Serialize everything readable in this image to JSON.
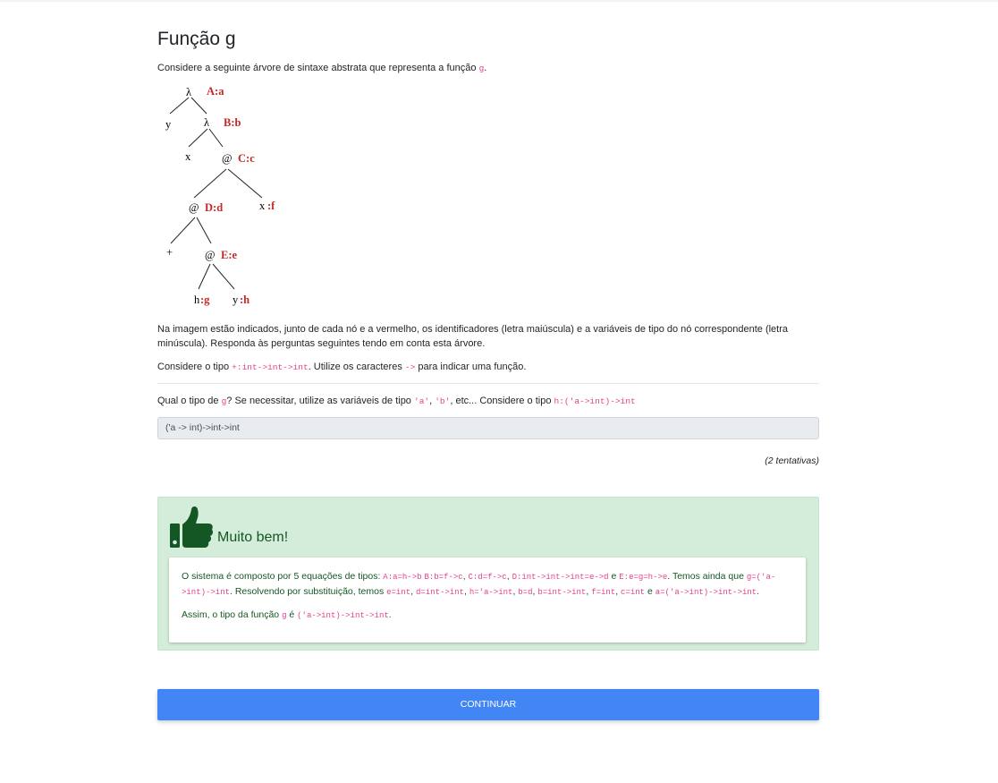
{
  "page": {
    "title": "Função g"
  },
  "intro": {
    "text": "Considere a seguinte árvore de sintaxe abstrata que representa a função ",
    "code": "g",
    "end": "."
  },
  "tree": {
    "nodes": {
      "lambda1": "λ",
      "lambda1_label": "A:a",
      "y1": "y",
      "lambda2": "λ",
      "lambda2_label": "B:b",
      "x1": "x",
      "at1": "@",
      "at1_label": "C:c",
      "at2": "@",
      "at2_label": "D:d",
      "x2": "x",
      "x2_label": ":f",
      "plus": "+",
      "at3": "@",
      "at3_label": "E:e",
      "h": "h",
      "h_label": ":g",
      "y2": "y",
      "y2_label": ":h"
    }
  },
  "description": "Na imagem estão indicados, junto de cada nó e a vermelho, os identificadores (letra maiúscula) e a variáveis de tipo do nó correspondente (letra minúscula). Responda às perguntas seguintes tendo em conta esta árvore.",
  "consider": {
    "a": "Considere o tipo ",
    "code1": "+:int->int->int",
    "b": ". Utilize os caracteres ",
    "code2": "->",
    "c": " para indicar uma função."
  },
  "question": {
    "a": "Qual o tipo de ",
    "code1": "g",
    "b": "? Se necessitar, utilize as variáveis de tipo ",
    "code2": "'a'",
    "c": ", ",
    "code3": "'b'",
    "d": ", etc... Considere o tipo ",
    "code4": "h:('a->int)->int"
  },
  "answer": {
    "value": "('a -> int)->int->int"
  },
  "attempts": "(2 tentativas)",
  "feedback": {
    "heading": "Muito bem!",
    "line1": {
      "t1": "O sistema é composto por 5 equações de tipos: ",
      "c1": "A:a=h->b",
      "t2": " ",
      "c2": "B:b=f->c",
      "t3": ", ",
      "c3": "C:d=f->c",
      "t4": ", ",
      "c4": "D:int->int->int=e->d",
      "t5": " e ",
      "c5": "E:e=g=h->e",
      "t6": ". Temos ainda que ",
      "c6a": "g=('a-",
      "c6b": ">int)->int",
      "t7": ". Resolvendo por substituição, temos ",
      "c7": "e=int",
      "t8": ", ",
      "c8": "d=int->int",
      "t9": ", ",
      "c9": "h='a->int",
      "t10": ", ",
      "c10": "b=d",
      "t11": ", ",
      "c11": "b=int->int",
      "t12": ", ",
      "c12": "f=int",
      "t13": ", ",
      "c13": "c=int",
      "t14": " e ",
      "c14": "a=('a->int)->int->int",
      "t15": "."
    },
    "line2": {
      "t1": "Assim, o tipo da função ",
      "c1": "g",
      "t2": " é ",
      "c2": "('a->int)->int->int",
      "t3": "."
    }
  },
  "button": {
    "label": "Continuar"
  },
  "colors": {
    "accent": "#4285f4",
    "success_bg": "#d4edda",
    "success_text": "#155724",
    "code": "#e83e8c",
    "tree_label": "#c62828"
  }
}
